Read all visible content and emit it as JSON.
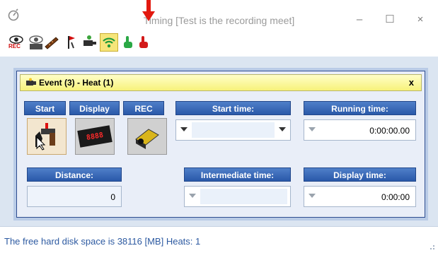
{
  "window": {
    "title": "Timing [Test is the recording meet]",
    "minimize_label": "–",
    "maximize_label": "☐",
    "close_label": "×"
  },
  "toolbar": {
    "items": [
      {
        "icon": "eye-rec-icon",
        "caption": "REC"
      },
      {
        "icon": "eye-display-icon"
      },
      {
        "icon": "ruler-icon"
      },
      {
        "icon": "flag-icon"
      },
      {
        "icon": "camera-hand-icon"
      },
      {
        "icon": "wifi-icon",
        "active": true
      },
      {
        "icon": "green-hand-icon"
      },
      {
        "icon": "red-hand-icon"
      }
    ]
  },
  "event_window": {
    "title": "Event (3) - Heat (1)",
    "close_label": "x",
    "labels": {
      "start": "Start",
      "display": "Display",
      "rec": "REC",
      "start_time": "Start time:",
      "running_time": "Running time:",
      "distance": "Distance:",
      "intermediate_time": "Intermediate time:",
      "display_time": "Display time:"
    },
    "values": {
      "start_time": "",
      "running_time": "0:00:00.00",
      "distance": "0",
      "intermediate_time": "",
      "display_time": "0:00:00"
    },
    "display_tile_text": "8888"
  },
  "statusbar": {
    "text": "The free hard disk space is 38116 [MB]  Heats: 1"
  },
  "colors": {
    "header_blue": "#2f5fae",
    "status_text": "#2d5aa1",
    "child_title_yellow": "#f7f27a",
    "workarea": "#dbe5f1",
    "annotation_red": "#e2190f"
  }
}
